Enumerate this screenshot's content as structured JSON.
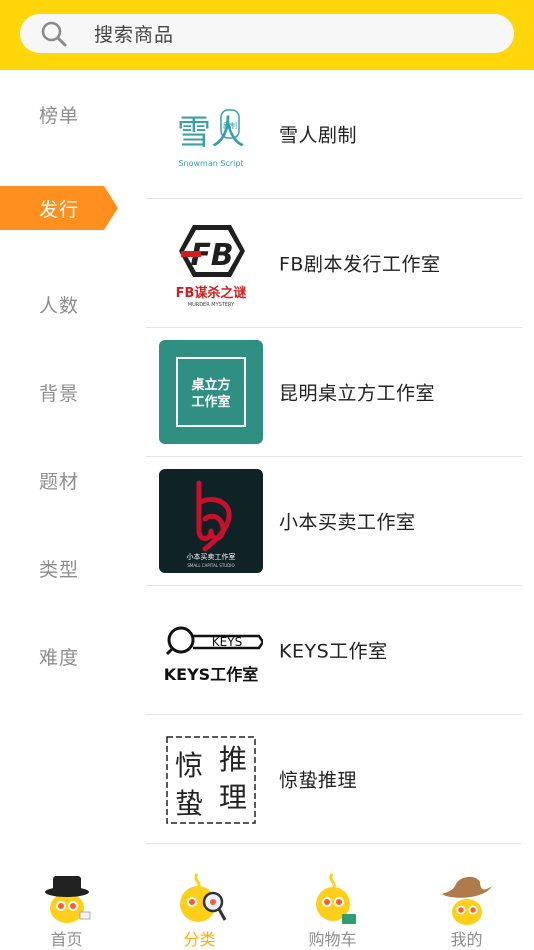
{
  "search": {
    "placeholder": "搜索商品"
  },
  "sidebar": {
    "items": [
      {
        "label": "榜单",
        "active": false
      },
      {
        "label": "发行",
        "active": true
      },
      {
        "label": "人数",
        "active": false
      },
      {
        "label": "背景",
        "active": false
      },
      {
        "label": "题材",
        "active": false
      },
      {
        "label": "类型",
        "active": false
      },
      {
        "label": "难度",
        "active": false
      }
    ]
  },
  "studios": [
    {
      "name": "雪人剧制",
      "logo_text": "雪人",
      "logo_badge": "剧制",
      "logo_sub": "Snowman Script",
      "logo": "snowman-logo"
    },
    {
      "name": "FB剧本发行工作室",
      "logo_text": "FB",
      "logo_sub": "FB谋杀之谜",
      "logo_tiny": "MURDER MYSTERY",
      "logo": "fb-logo"
    },
    {
      "name": "昆明桌立方工作室",
      "logo_line1": "桌立方",
      "logo_line2": "工作室",
      "logo": "zhuolifang-logo"
    },
    {
      "name": "小本买卖工作室",
      "logo_line1": "小本买卖工作室",
      "logo_line2": "SMALL CAPITAL STUDIO",
      "logo": "xiaoben-logo"
    },
    {
      "name": "KEYS工作室",
      "logo_line1": "KEYS",
      "logo_line2": "KEYS工作室",
      "logo": "keys-logo"
    },
    {
      "name": "惊蛰推理",
      "logo_chars": [
        "惊",
        "推",
        "蛰",
        "理"
      ],
      "logo": "jingzhe-logo"
    }
  ],
  "tabbar": {
    "tabs": [
      {
        "label": "首页",
        "icon": "home-mascot-icon",
        "active": false
      },
      {
        "label": "分类",
        "icon": "category-mascot-icon",
        "active": true
      },
      {
        "label": "购物车",
        "icon": "cart-mascot-icon",
        "active": false
      },
      {
        "label": "我的",
        "icon": "profile-mascot-icon",
        "active": false
      }
    ]
  },
  "colors": {
    "header": "#ffd60a",
    "accent": "#ff8f1e",
    "tab_active": "#ffaf00",
    "zhuolifang_bg": "#2f8f83",
    "xiaoben_bg": "#0f2226",
    "xiaoben_red": "#c8102e"
  }
}
